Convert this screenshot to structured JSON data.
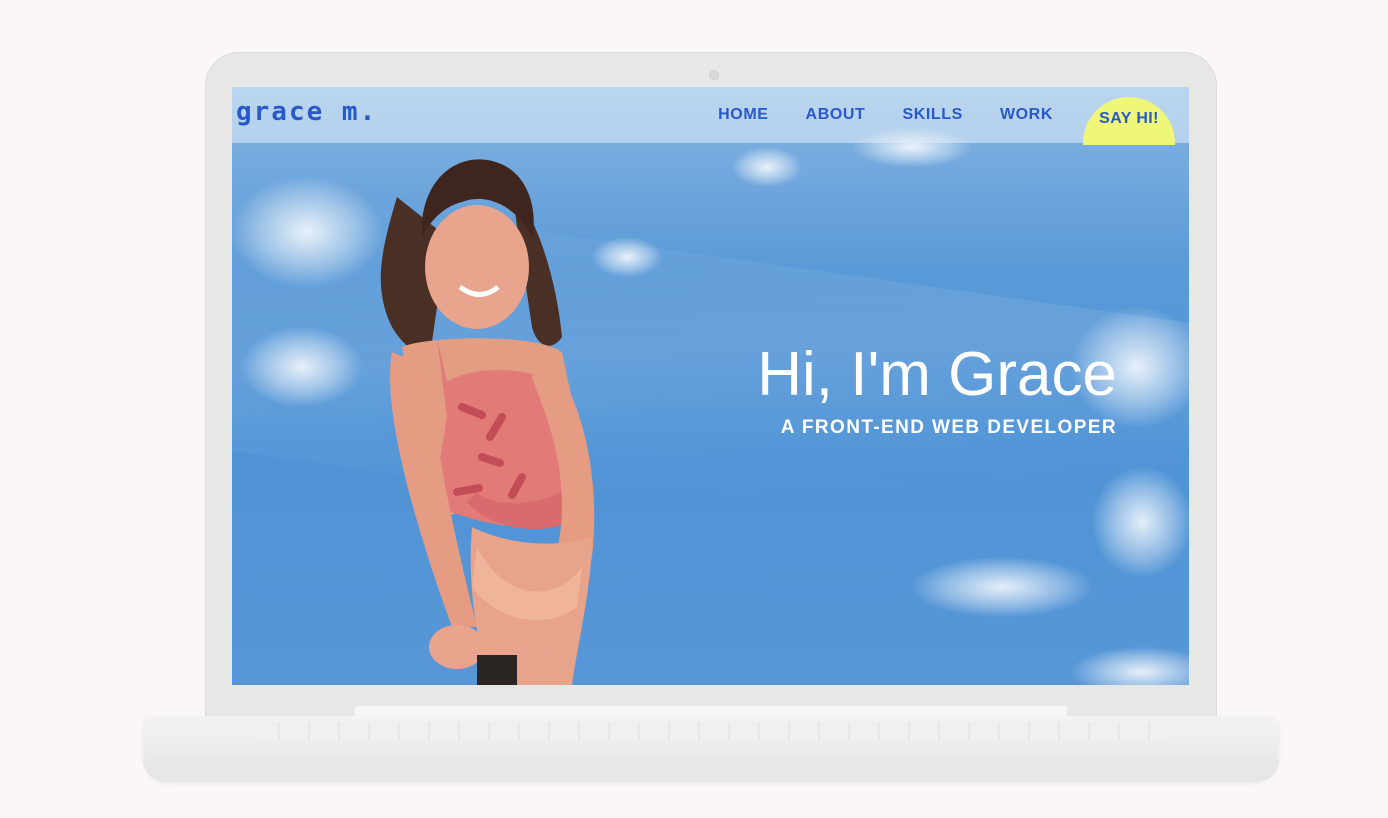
{
  "site": {
    "logo": "grace m.",
    "nav": {
      "items": [
        "HOME",
        "ABOUT",
        "SKILLS",
        "WORK"
      ],
      "cta": "SAY HI!"
    },
    "hero": {
      "title": "Hi, I'm Grace",
      "subtitle": "A FRONT-END WEB DEVELOPER"
    }
  },
  "colors": {
    "brand_blue": "#2759c9",
    "cta_yellow": "#eef779",
    "sky_blue": "#5b9ad8",
    "page_bg": "#faf7f6",
    "laptop_gray": "#e7e7e6"
  }
}
